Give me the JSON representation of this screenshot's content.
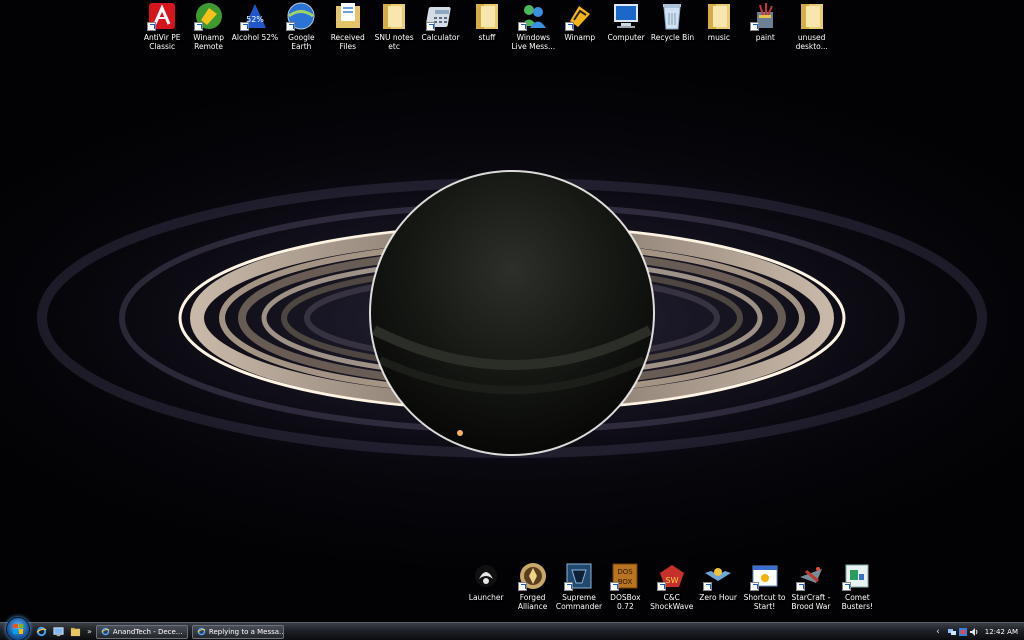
{
  "desktop": {
    "top_icons": [
      {
        "label": "AntiVir PE\nClassic",
        "icon": "antivir-icon",
        "shortcut": true
      },
      {
        "label": "Winamp\nRemote",
        "icon": "winamp-remote-icon",
        "shortcut": true
      },
      {
        "label": "Alcohol 52%",
        "icon": "alcohol-icon",
        "shortcut": true
      },
      {
        "label": "Google Earth",
        "icon": "google-earth-icon",
        "shortcut": true
      },
      {
        "label": "Received\nFiles",
        "icon": "folder-files-icon",
        "shortcut": false
      },
      {
        "label": "SNU notes\netc",
        "icon": "folder-icon",
        "shortcut": false
      },
      {
        "label": "Calculator",
        "icon": "calculator-icon",
        "shortcut": true
      },
      {
        "label": "stuff",
        "icon": "folder-icon",
        "shortcut": false
      },
      {
        "label": "Windows\nLive Mess...",
        "icon": "messenger-icon",
        "shortcut": true
      },
      {
        "label": "Winamp",
        "icon": "winamp-icon",
        "shortcut": true
      },
      {
        "label": "Computer",
        "icon": "computer-icon",
        "shortcut": false
      },
      {
        "label": "Recycle Bin",
        "icon": "recycle-bin-icon",
        "shortcut": false
      },
      {
        "label": "music",
        "icon": "folder-icon",
        "shortcut": false
      },
      {
        "label": "paint",
        "icon": "paint-icon",
        "shortcut": true
      },
      {
        "label": "unused\ndeskto...",
        "icon": "folder-icon",
        "shortcut": false
      }
    ],
    "bottom_icons": [
      {
        "label": "Launcher",
        "icon": "launcher-icon",
        "shortcut": false
      },
      {
        "label": "Forged\nAlliance",
        "icon": "forged-alliance-icon",
        "shortcut": true
      },
      {
        "label": "Supreme\nCommander",
        "icon": "supreme-commander-icon",
        "shortcut": true
      },
      {
        "label": "DOSBox 0.72",
        "icon": "dosbox-icon",
        "shortcut": true
      },
      {
        "label": "C&C\nShockWave",
        "icon": "cnc-shockwave-icon",
        "shortcut": true
      },
      {
        "label": "Zero Hour",
        "icon": "zero-hour-icon",
        "shortcut": true
      },
      {
        "label": "Shortcut to\nStart!",
        "icon": "start-shortcut-icon",
        "shortcut": true
      },
      {
        "label": "StarCraft -\nBrood War",
        "icon": "starcraft-icon",
        "shortcut": true
      },
      {
        "label": "Comet\nBusters!",
        "icon": "comet-busters-icon",
        "shortcut": true
      }
    ]
  },
  "taskbar": {
    "start_icon": "windows-logo-icon",
    "quick_launch": [
      "internet-explorer-icon",
      "show-desktop-icon",
      "folder-icon"
    ],
    "quick_launch_more": "»",
    "tasks": [
      {
        "label": "AnandTech - Dece...",
        "icon": "internet-explorer-icon"
      },
      {
        "label": "Replying to a Messa...",
        "icon": "internet-explorer-icon"
      }
    ],
    "tray_expand": "‹",
    "tray_icons": [
      "network-icon",
      "security-icon",
      "volume-icon"
    ],
    "clock": "12:42 AM"
  }
}
